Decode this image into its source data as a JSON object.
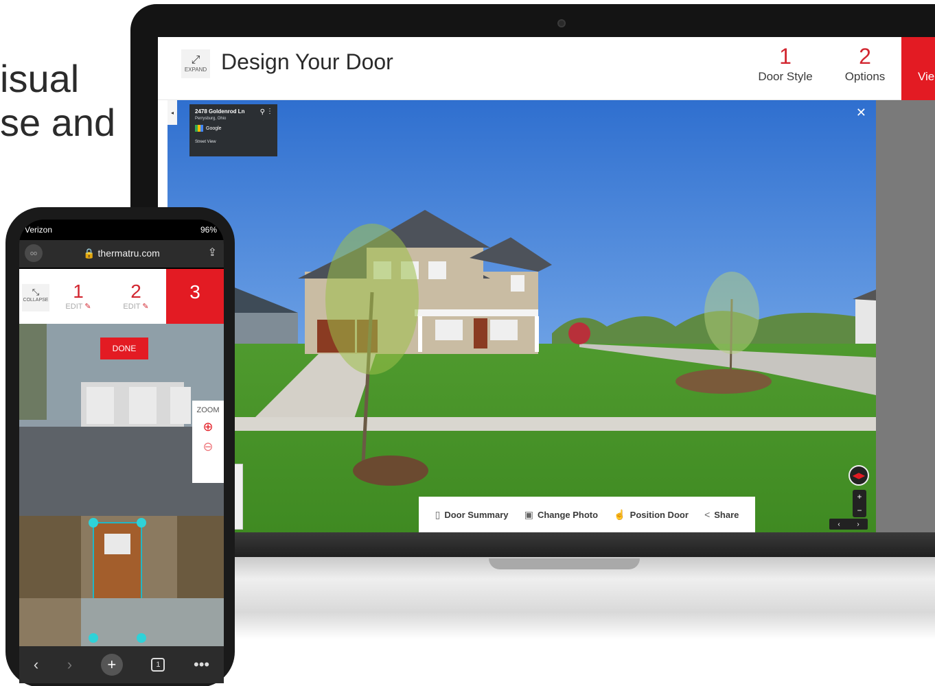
{
  "background": {
    "line1": "isual",
    "line2": "se and"
  },
  "laptop": {
    "header": {
      "expand_label": "EXPAND",
      "title": "Design Your Door",
      "steps": [
        {
          "num": "1",
          "label": "Door Style"
        },
        {
          "num": "2",
          "label": "Options"
        }
      ],
      "view_label": "Vie"
    },
    "location_card": {
      "address": "2478 Goldenrod Ln",
      "city": "Perrysburg, Ohio",
      "brand": "Google",
      "mode": "Street View"
    },
    "toolbar": [
      {
        "icon": "door-summary-icon",
        "glyph": "▯",
        "label": "Door Summary"
      },
      {
        "icon": "change-photo-icon",
        "glyph": "▣",
        "label": "Change Photo"
      },
      {
        "icon": "position-door-icon",
        "glyph": "☝",
        "label": "Position Door"
      },
      {
        "icon": "share-icon",
        "glyph": "<",
        "label": "Share"
      }
    ],
    "accent_color": "#e31b23"
  },
  "phone": {
    "carrier": "Verizon",
    "battery": "96%",
    "url": "thermatru.com",
    "collapse_label": "COLLAPSE",
    "steps": [
      {
        "num": "1",
        "edit": "EDIT"
      },
      {
        "num": "2",
        "edit": "EDIT"
      },
      {
        "num": "3"
      }
    ],
    "done_label": "DONE",
    "zoom_label": "ZOOM",
    "tab_count": "1"
  }
}
